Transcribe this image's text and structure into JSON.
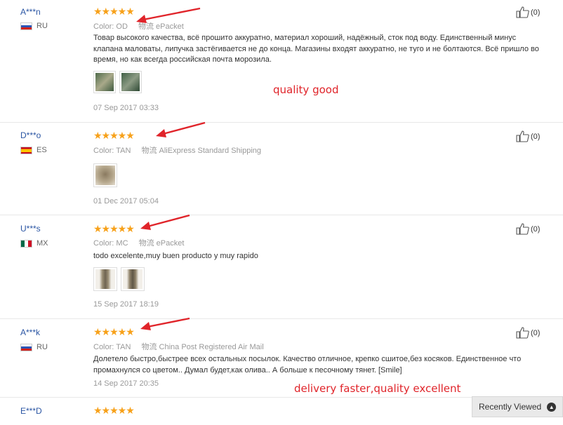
{
  "reviews": [
    {
      "user": "A***n",
      "country": "RU",
      "color_label": "Color:",
      "color": "OD",
      "shipping_label": "物流",
      "shipping": "ePacket",
      "text": "Товар высокого качества, всё прошито аккуратно, материал хороший, надёжный, сток под воду. Единственный минус клапана маловаты, липучка застёгивается не до конца. Магазины входят аккуратно, не туго и не болтаются. Всё пришло во время, но как всегда российская почта морозила.",
      "date": "07 Sep 2017 03:33",
      "helpful": "(0)",
      "rating": 5
    },
    {
      "user": "D***o",
      "country": "ES",
      "color_label": "Color:",
      "color": "TAN",
      "shipping_label": "物流",
      "shipping": "AliExpress Standard Shipping",
      "text": "",
      "date": "01 Dec 2017 05:04",
      "helpful": "(0)",
      "rating": 5
    },
    {
      "user": "U***s",
      "country": "MX",
      "color_label": "Color:",
      "color": "MC",
      "shipping_label": "物流",
      "shipping": "ePacket",
      "text": "todo excelente,muy buen producto y muy rapido",
      "date": "15 Sep 2017 18:19",
      "helpful": "(0)",
      "rating": 5
    },
    {
      "user": "A***k",
      "country": "RU",
      "color_label": "Color:",
      "color": "TAN",
      "shipping_label": "物流",
      "shipping": "China Post Registered Air Mail",
      "text": "Долетело быстро,быстрее всех остальных посылок. Качество отличное, крепко сшитое,без косяков. Единственное что промахнулся со цветом.. Думал будет,как олива.. А больше к песочному тянет. [Smile]",
      "date": "14 Sep 2017 20:35",
      "helpful": "(0)",
      "rating": 5
    },
    {
      "user": "E***D",
      "rating": 5
    }
  ],
  "annotations": {
    "first": "quality good",
    "second": "delivery faster,quality excellent"
  },
  "recently_viewed": "Recently Viewed",
  "colors": {
    "star": "#f7a11a",
    "username": "#2a55a3",
    "annotation": "#e0242a"
  }
}
